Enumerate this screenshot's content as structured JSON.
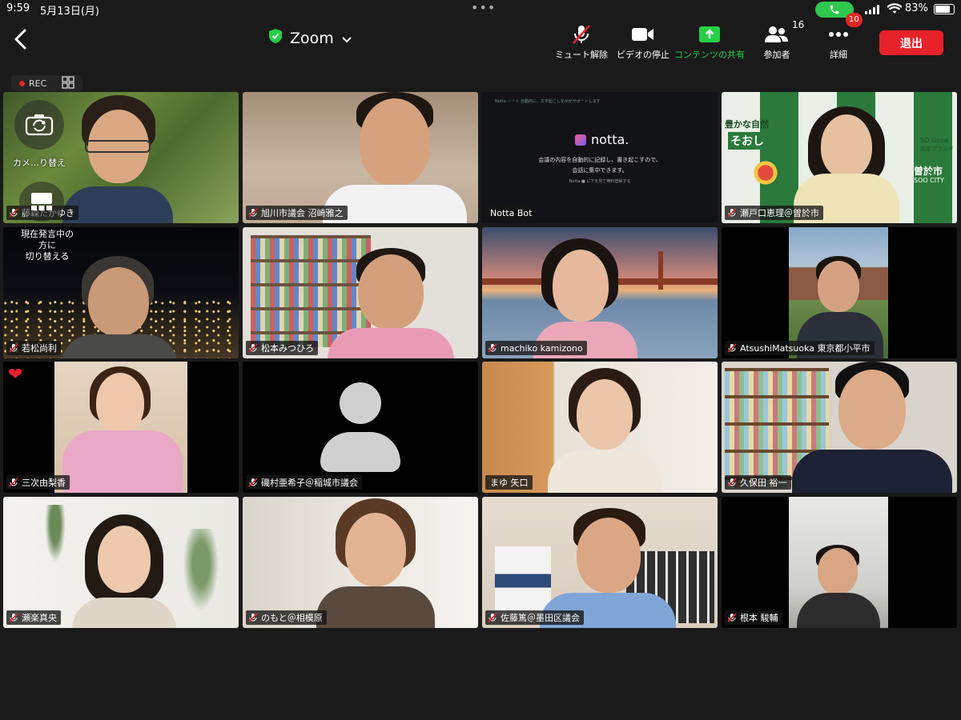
{
  "status_bar": {
    "time": "9:59",
    "date": "5月13日(月)",
    "battery": "83%",
    "battery_level": 0.83
  },
  "toolbar": {
    "title": "Zoom",
    "mute_label": "ミュート解除",
    "video_label": "ビデオの停止",
    "share_label": "コンテンツの共有",
    "participants_label": "参加者",
    "participants_count": "16",
    "more_label": "詳細",
    "more_badge": "10",
    "leave_label": "退出"
  },
  "rec": {
    "label": "REC"
  },
  "self_view": {
    "camera_switch_label": "カメ…り替え",
    "speaker_switch_label": "現在発言中の方に切り替える",
    "speaker_switch_lines": [
      "現在発言中の",
      "方に",
      "切り替える"
    ]
  },
  "colors": {
    "accent_green": "#25d046",
    "leave_red": "#e8222a",
    "background": "#1a1a1a"
  },
  "participants": [
    {
      "name": "藤森たかゆき",
      "muted": true
    },
    {
      "name": "旭川市議会 沼崎雅之",
      "muted": true
    },
    {
      "name": "Notta Bot",
      "muted": false
    },
    {
      "name": "瀬戸口恵理＠曽於市",
      "muted": true
    },
    {
      "name": "若松尚利",
      "muted": true
    },
    {
      "name": "松本みつひろ",
      "muted": true
    },
    {
      "name": "machiko kamizono",
      "muted": true
    },
    {
      "name": "AtsushiMatsuoka 東京都小平市",
      "muted": true
    },
    {
      "name": "三次由梨香",
      "muted": true
    },
    {
      "name": "磯村亜希子＠稲城市議会",
      "muted": true
    },
    {
      "name": "まゆ 矢口",
      "muted": false
    },
    {
      "name": "久保田 裕一",
      "muted": true
    },
    {
      "name": "瀬楽真央",
      "muted": true
    },
    {
      "name": "のもと＠相模原",
      "muted": true
    },
    {
      "name": "佐藤篤＠墨田区議会",
      "muted": true
    },
    {
      "name": "根本 駿輔",
      "muted": true
    }
  ],
  "notta_screen": {
    "logo": "notta.",
    "header_text": "Notta ノート  自動的に、文字起こしをAIがサポートします",
    "line1": "会議の内容を自動的に記録し、書き起こすので、",
    "line2": "会話に集中できます。",
    "footer": "Notta ■ に下を見て無料登録する"
  },
  "soo_backdrop": {
    "text_a": "豊かな自然",
    "text_b": "そおし",
    "text_c": "曽於市",
    "text_d": "SOO CITY",
    "text_e": "SO Good",
    "text_f": "認定ブランド"
  }
}
